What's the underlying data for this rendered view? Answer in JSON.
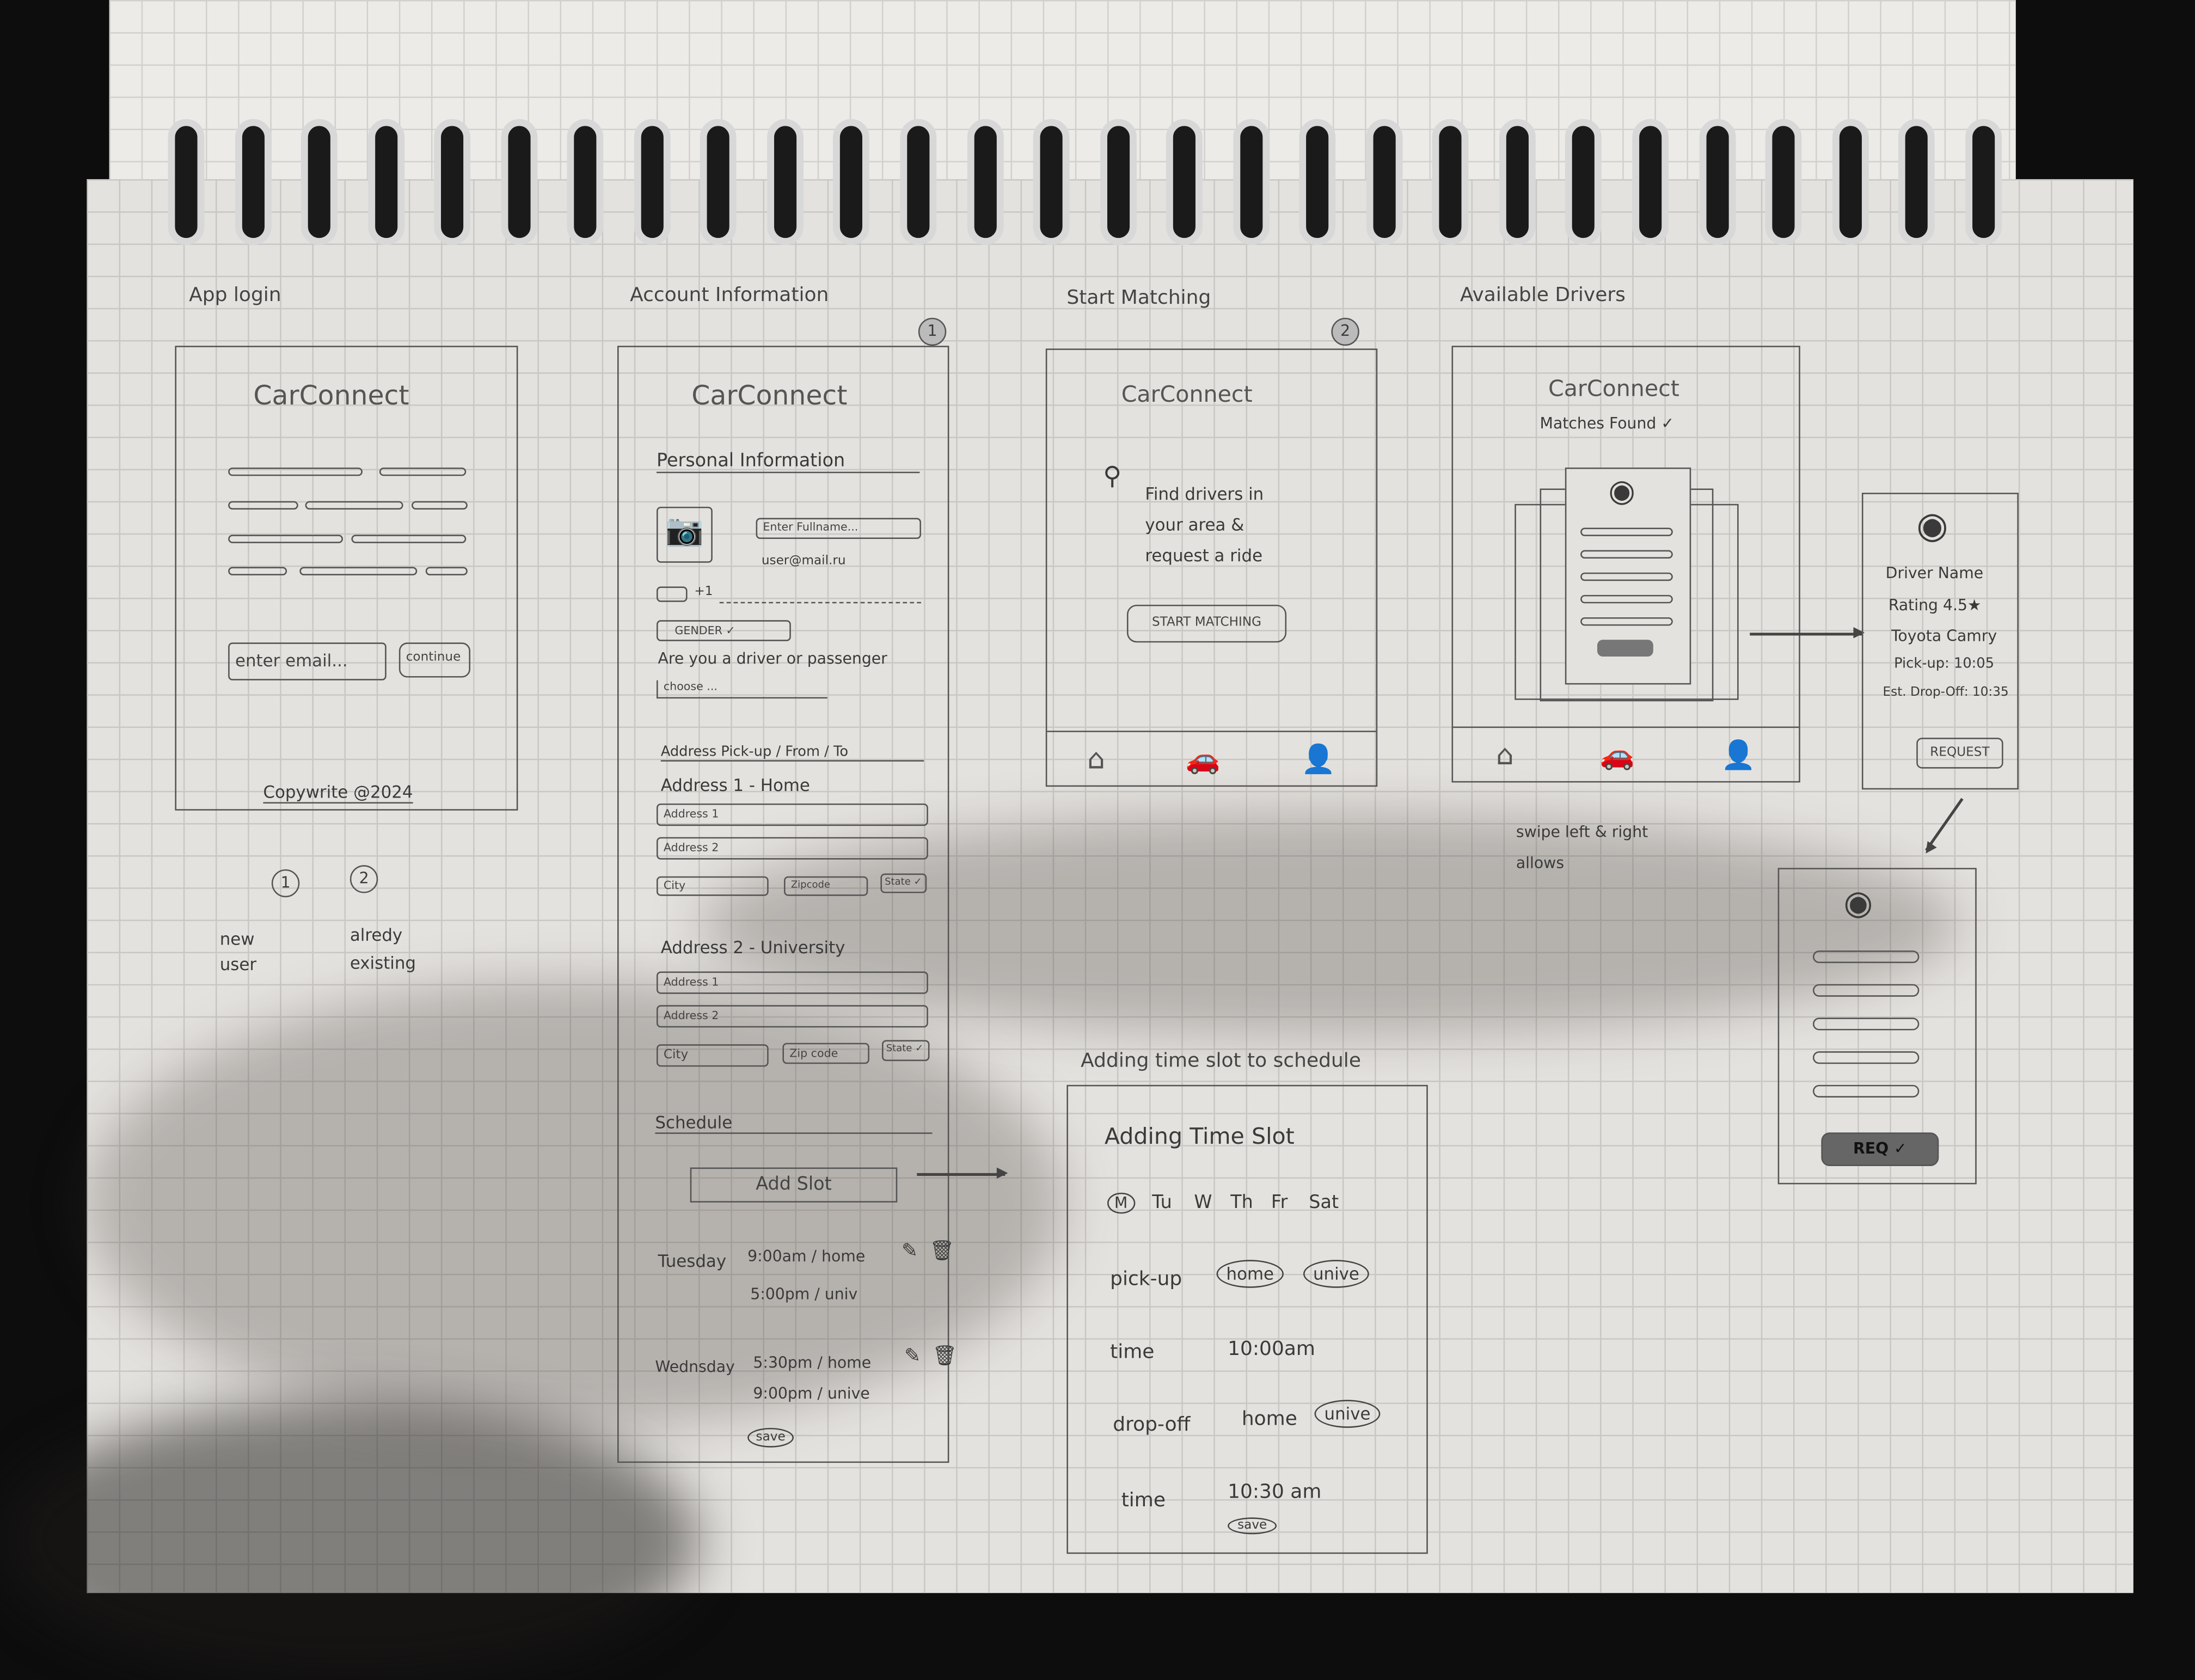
{
  "app_login": {
    "label": "App login",
    "brand": "CarConnect",
    "email_placeholder": "enter email...",
    "continue_label": "continue",
    "footer": "Copywrite @2024",
    "annotations": [
      {
        "number": "1",
        "text": "new user"
      },
      {
        "number": "2",
        "text": "alredy existing"
      }
    ]
  },
  "account_info": {
    "label": "Account Information",
    "step": "1",
    "brand": "CarConnect",
    "personal_heading": "Personal Information",
    "fullname_placeholder": "Enter Fullname...",
    "email": "user@mail.ru",
    "phone_prefix": "+1",
    "gender": "GENDER ✓",
    "role_question": "Are you a driver or passenger",
    "role_select": "choose ...",
    "address_heading": "Address Pick-up / From / To",
    "addresses": [
      {
        "title": "Address 1 - Home",
        "line1": "Address 1",
        "line2": "Address 2",
        "city": "City",
        "zip": "Zipcode",
        "state": "State ✓"
      },
      {
        "title": "Address 2 - University",
        "line1": "Address 1",
        "line2": "Address 2",
        "city": "City",
        "zip": "Zip code",
        "state": "State ✓"
      }
    ],
    "schedule_heading": "Schedule",
    "add_slot": "Add Slot",
    "slots": [
      {
        "day": "Tuesday",
        "pickup": "9:00am / home",
        "dropoff": "5:00pm / univ"
      },
      {
        "day": "Wednsday",
        "pickup": "5:30pm / home",
        "dropoff": "9:00pm / unive"
      }
    ],
    "save": "save"
  },
  "start_matching": {
    "label": "Start Matching",
    "step": "2",
    "brand": "CarConnect",
    "message": "Find drivers in your area & request a ride",
    "button": "START MATCHING"
  },
  "available_drivers": {
    "label": "Available Drivers",
    "brand": "CarConnect",
    "subtitle": "Matches Found ✓",
    "note": "swipe left & right allows"
  },
  "driver_detail": {
    "name": "Driver Name",
    "rating": "Rating 4.5★",
    "car": "Toyota Camry",
    "pickup": "Pick-up: 10:05",
    "dropoff": "Est. Drop-Off: 10:35",
    "button": "REQUEST"
  },
  "request_sent": {
    "button": "REQ ✓"
  },
  "time_slot": {
    "label": "Adding time slot to schedule",
    "title": "Adding Time Slot",
    "days": [
      "M",
      "Tu",
      "W",
      "Th",
      "Fr",
      "Sat"
    ],
    "pickup_label": "pick-up",
    "pickup_options": [
      "home",
      "unive"
    ],
    "time1_label": "time",
    "time1": "10:00am",
    "dropoff_label": "drop-off",
    "dropoff_options": [
      "home",
      "unive"
    ],
    "time2_label": "time",
    "time2": "10:30 am",
    "save": "save"
  }
}
